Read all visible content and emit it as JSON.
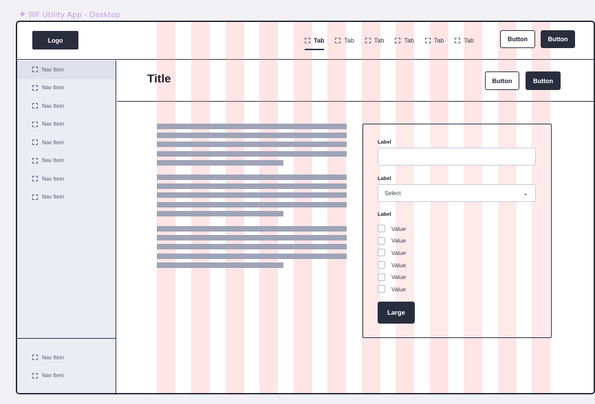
{
  "window": {
    "title": "WF Utility App - Desktop"
  },
  "header": {
    "logo": "Logo",
    "tabs": [
      {
        "label": "Tab",
        "icon": "placeholder-icon",
        "active": true
      },
      {
        "label": "Tab",
        "icon": "placeholder-icon"
      },
      {
        "label": "Tab",
        "icon": "placeholder-icon"
      },
      {
        "label": "Tab",
        "icon": "placeholder-icon"
      },
      {
        "label": "Tab",
        "icon": "placeholder-icon"
      },
      {
        "label": "Tab",
        "icon": "placeholder-icon"
      }
    ],
    "button_secondary": "Button",
    "button_primary": "Button"
  },
  "sidebar": {
    "items": [
      {
        "label": "Nav Item",
        "active": true
      },
      {
        "label": "Nav Item"
      },
      {
        "label": "Nav Item"
      },
      {
        "label": "Nav Item"
      },
      {
        "label": "Nav Item"
      },
      {
        "label": "Nav Item"
      },
      {
        "label": "Nav Item"
      },
      {
        "label": "Nav Item"
      }
    ],
    "bottom_items": [
      {
        "label": "Nav Item"
      },
      {
        "label": "Nav Item"
      }
    ]
  },
  "page": {
    "title": "Title",
    "button_secondary": "Button",
    "button_primary": "Button"
  },
  "form": {
    "input_label": "Label",
    "input_value": "",
    "select_label": "Label",
    "select_value": "Select",
    "checkbox_label": "Label",
    "checkboxes": [
      "Value",
      "Value",
      "Value",
      "Value",
      "Value",
      "Value"
    ],
    "submit": "Large"
  },
  "colors": {
    "primary": "#2a2d3e",
    "sidebar_bg": "#ebedf5",
    "grid_overlay": "#ffd6d6",
    "text_skeleton": "#9fa4b8",
    "window_title": "#c99be6"
  }
}
